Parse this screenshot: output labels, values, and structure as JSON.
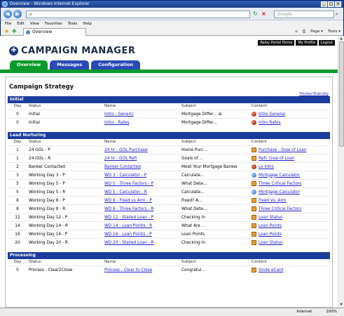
{
  "window": {
    "title": "Overview - Windows Internet Explorer"
  },
  "address": {
    "url": "e",
    "search_placeholder": "Google"
  },
  "menu": [
    "File",
    "Edit",
    "View",
    "Favorites",
    "Tools",
    "Help"
  ],
  "favorites": {
    "tab": "Overview",
    "commands": [
      "Page ▾",
      "Tools ▾"
    ]
  },
  "toplinks": [
    "Relay Portal Home",
    "My Profile",
    "Logout"
  ],
  "app": {
    "title": "CAMPAIGN MANAGER",
    "tabs": [
      "Overview",
      "Messages",
      "Configuration"
    ]
  },
  "page": {
    "title": "Campaign Strategy",
    "printer_friendly": "Printer-Friendly"
  },
  "columns": {
    "day": "Day",
    "status": "Status",
    "name": "Name",
    "subject": "Subject",
    "content": "Content"
  },
  "sections": [
    {
      "title": "Initial",
      "rows": [
        {
          "day": "0",
          "status": "Initial",
          "name": "Intro - Generic",
          "subject": "Mortgage Differ... al",
          "content": "Intro General",
          "icon": "red"
        },
        {
          "day": "0",
          "status": "Initial",
          "name": "Intro - Rates",
          "subject": "Mortgage Differ...",
          "content": "Intro Rates",
          "icon": "red"
        }
      ]
    },
    {
      "title": "Lead Nurturing",
      "rows": [
        {
          "day": "1",
          "status": "24 GOL - P",
          "name": "24 hr - GOL Purchase",
          "subject": "Home Purc...",
          "content": "Purchase - Goal of Loan",
          "icon": "doc"
        },
        {
          "day": "1",
          "status": "24 GOL - R",
          "name": "24 hr - GOL Refi",
          "subject": "Goals of ...",
          "content": "Refi- Goal of Loan",
          "icon": "doc"
        },
        {
          "day": "2",
          "status": "Banker Contacted",
          "name": "Banker Contacted",
          "subject": "Meet Your Mortgage Banker",
          "content": "Lo Intro",
          "icon": "red"
        },
        {
          "day": "3",
          "status": "Working Day 3 - P",
          "name": "WD 3 - Calculator - P",
          "subject": "Calculate...",
          "content": "Mortgage Calculator",
          "icon": "globe"
        },
        {
          "day": "5",
          "status": "Working Day 5 - P",
          "name": "WD 5 - Three Factors - P",
          "subject": "What Dete...",
          "content": "Three Critical Factors",
          "icon": "doc"
        },
        {
          "day": "5",
          "status": "Working Day 5 - R",
          "name": "WD 5 - Calculator - R",
          "subject": "Calculate...",
          "content": "Mortgage Calculator",
          "icon": "globe"
        },
        {
          "day": "8",
          "status": "Working Day 8 - P",
          "name": "WD 8 - Fixed vs Arm - P",
          "subject": "Fixed? A...",
          "content": "Fixed Vs. Arm",
          "icon": "doc"
        },
        {
          "day": "8",
          "status": "Working Day 8 - R",
          "name": "WD 8 - Three Factors - R",
          "subject": "What Dete...",
          "content": "Three Critical Factors",
          "icon": "doc"
        },
        {
          "day": "12",
          "status": "Working Day 12 - P",
          "name": "WD 12 - Stalled Loan - P",
          "subject": "Checking In",
          "content": "Loan Status",
          "icon": "doc"
        },
        {
          "day": "14",
          "status": "Working Day 14 - R",
          "name": "WD 14 - Loan Points - R",
          "subject": "What Are ...",
          "content": "Loan Points",
          "icon": "doc"
        },
        {
          "day": "16",
          "status": "Working Day 16 - P",
          "name": "WD 16 - Loan Points - P",
          "subject": "Loan Points",
          "content": "Loan Points",
          "icon": "doc"
        },
        {
          "day": "20",
          "status": "Working Day 20 - R",
          "name": "WD 20 - Stalled Loan - R",
          "subject": "Checking In",
          "content": "Loan Status",
          "icon": "doc"
        }
      ]
    },
    {
      "title": "Processing",
      "rows": [
        {
          "day": "0",
          "status": "Process - Clear2Close",
          "name": "Process - Clear to Close",
          "subject": "Congratul...",
          "content": "Smile eCard",
          "icon": "doc"
        }
      ]
    }
  ],
  "statusbar": {
    "zone": "Internet",
    "zoom": "100%"
  }
}
